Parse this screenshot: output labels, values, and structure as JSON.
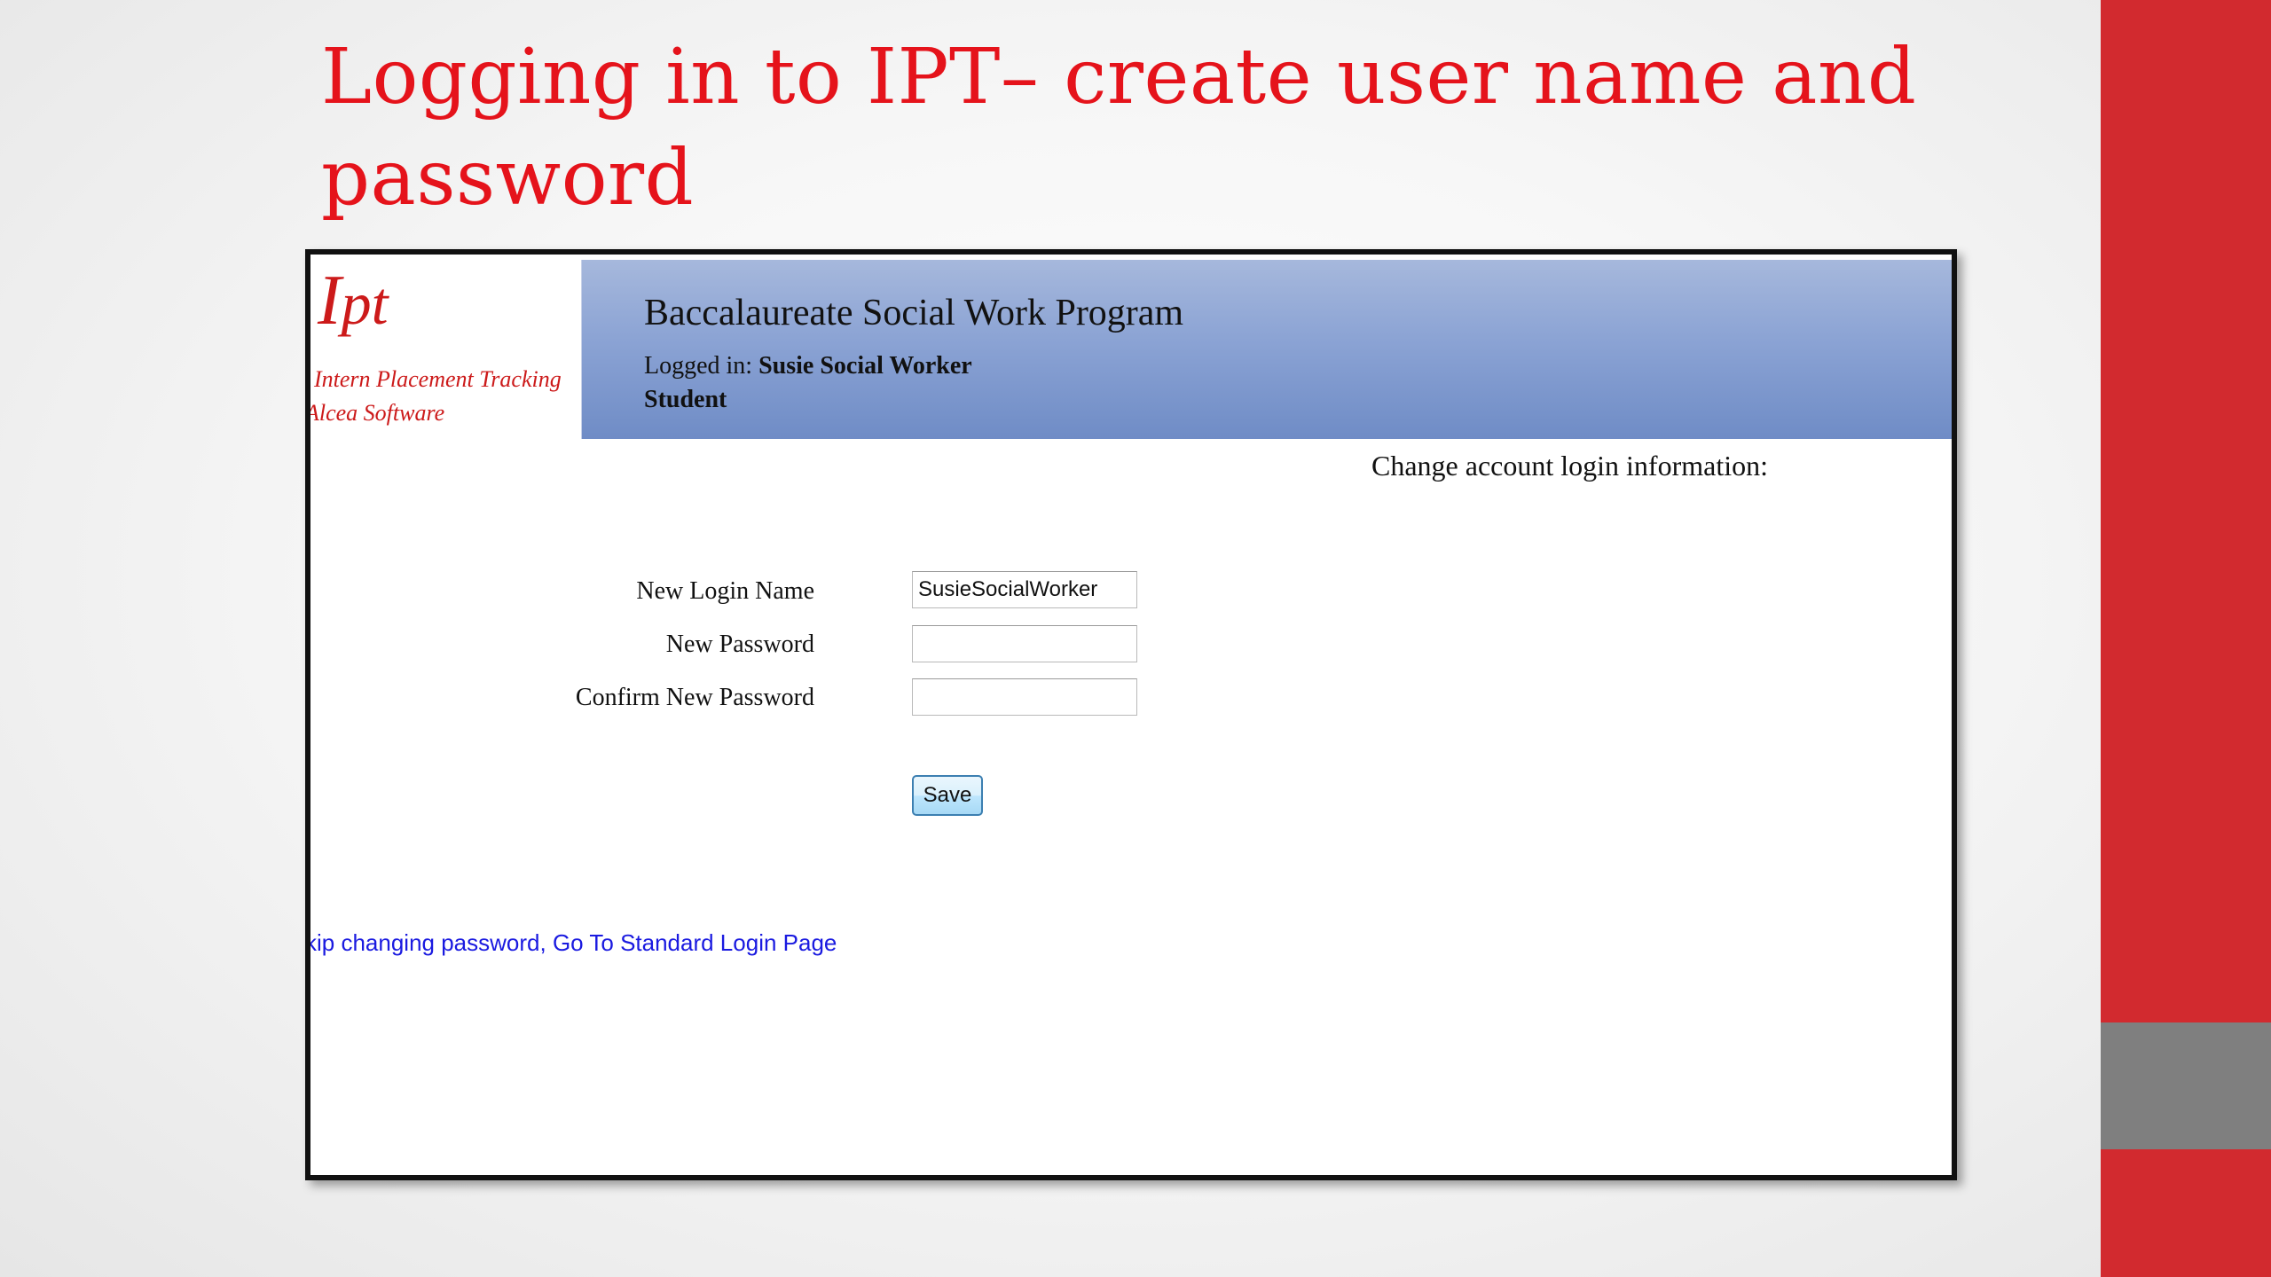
{
  "slide": {
    "title": "Logging in to IPT– create user name and password"
  },
  "app": {
    "logo": {
      "mark_initial": "I",
      "mark_rest": "pt",
      "line1": "Intern Placement Tracking",
      "line2": "Alcea Software"
    },
    "header": {
      "program_title": "Baccalaureate Social Work Program",
      "logged_in_label": "Logged in:",
      "logged_in_user": "Susie Social Worker",
      "role": "Student"
    },
    "form": {
      "heading": "Change account login information:",
      "new_login_label": "New Login Name",
      "new_login_value": "SusieSocialWorker",
      "new_password_label": "New Password",
      "new_password_value": "",
      "confirm_password_label": "Confirm New Password",
      "confirm_password_value": "",
      "save_label": "Save"
    },
    "skip_link": "kip changing password, Go To Standard Login Page"
  },
  "colors": {
    "title_red": "#e5131b",
    "band_red": "#d22a2f",
    "band_gray": "#7f7f7f",
    "header_blue": "#8ba3d4",
    "link_blue": "#1a1ae0"
  }
}
